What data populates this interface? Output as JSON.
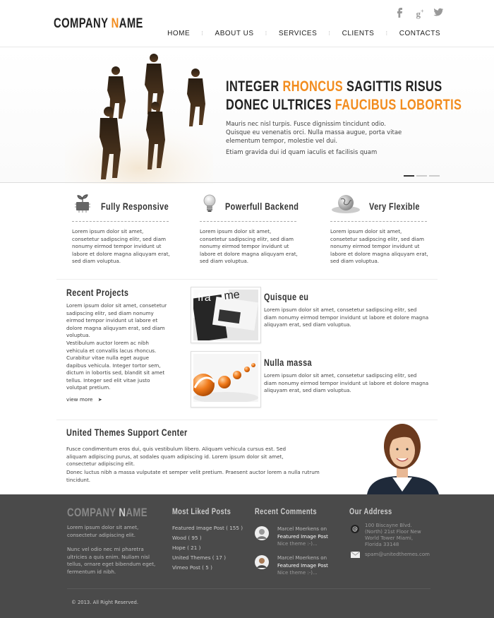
{
  "header": {
    "logo_part1": "COMPANY ",
    "logo_accent": "N",
    "logo_part2": "AME",
    "social": [
      "f",
      "g+",
      "twitter"
    ],
    "nav": [
      "HOME",
      "ABOUT US",
      "SERVICES",
      "CLIENTS",
      "CONTACTS"
    ]
  },
  "hero": {
    "line1_a": "INTEGER ",
    "line1_accent": "RHONCUS",
    "line1_b": " SAGITTIS RISUS",
    "line2_a": "DONEC ULTRICES ",
    "line2_accent": "FAUCIBUS LOBORTIS",
    "paragraph": "Mauris nec nisl turpis. Fusce dignissim tincidunt odio. Quisque eu venenatis orci. Nulla massa augue, porta vitae elementum tempor, molestie vel dui.",
    "paragraph2": "Etiam gravida dui id quam iaculis et facilisis quam"
  },
  "features": [
    {
      "title": "Fully Responsive",
      "icon": "chip-plant-icon",
      "text": "Lorem ipsum dolor sit amet, consetetur sadipscing elitr, sed diam nonumy eirmod tempor invidunt ut labore et dolore magna aliquyam erat, sed diam voluptua."
    },
    {
      "title": "Powerfull Backend",
      "icon": "lightbulb-icon",
      "text": "Lorem ipsum dolor sit amet, consetetur sadipscing elitr, sed diam nonumy eirmod tempor invidunt ut labore et dolore magna aliquyam erat, sed diam voluptua."
    },
    {
      "title": "Very Flexible",
      "icon": "globe-icon",
      "text": "Lorem ipsum dolor sit amet, consetetur sadipscing elitr, sed diam nonumy eirmod tempor invidunt ut labore et dolore magna aliquyam erat, sed diam voluptua."
    }
  ],
  "recent": {
    "title": "Recent Projects",
    "p1": "Lorem ipsum dolor sit amet, consetetur sadipscing elitr, sed diam nonumy eirmod tempor invidunt ut labore et dolore magna aliquyam erat, sed diam voluptua.",
    "p2": "Vestibulum auctor lorem ac nibh vehicula et convallis lacus rhoncus. Curabitur vitae nulla eget augue dapibus vehicula. Integer tortor sem, dictum in lobortis sed, blandit sit amet tellus. Integer sed elit vitae justo volutpat pretium.",
    "view_more": "view more",
    "projects": [
      {
        "title": "Quisque eu",
        "thumb_text": "frame",
        "text": "Lorem ipsum dolor sit amet, consetetur sadipscing elitr, sed diam nonumy eirmod tempor invidunt ut labore et dolore magna aliquyam erat, sed diam voluptua."
      },
      {
        "title": "Nulla massa",
        "text": "Lorem ipsum dolor sit amet, consetetur sadipscing elitr, sed diam nonumy eirmod tempor invidunt ut labore et dolore magna aliquyam erat, sed diam voluptua."
      }
    ]
  },
  "support": {
    "title": "United Themes Support Center",
    "p1": "Fusce condimentum eros dui, quis vestibulum libero. Aliquam vehicula cursus est. Sed aliquam adipiscing purus, at sodales quam adipiscing id. Lorem ipsum dolor sit amet, consectetur adipiscing elit.",
    "p2": "Donec luctus nibh a massa vulputate et semper velit pretium. Praesent auctor lorem a nulla rutrum tincidunt."
  },
  "footer": {
    "logo_part1": "COMPANY ",
    "logo_accent": "N",
    "logo_part2": "AME",
    "about1": "Lorem ipsum dolor sit amet, consectetur adipiscing elit.",
    "about2": "Nunc vel odio nec mi pharetra ultricies a quis enim. Nullam nisl tellus, ornare eget bibendum eget, fermentum id nibh.",
    "liked_title": "Most Liked Posts",
    "liked": [
      "Featured Image Post ( 155 )",
      "Wood ( 95 )",
      "Hope ( 21 )",
      "United Themes ( 17 )",
      "Vimeo Post ( 5 )"
    ],
    "comments_title": "Recent Comments",
    "comments": [
      {
        "author": "Marcel Moerkens on",
        "post": "Featured Image Post",
        "text": "Nice theme :-)..."
      },
      {
        "author": "Marcel Moerkens on",
        "post": "Featured Image Post",
        "text": "Nice theme :-)..."
      }
    ],
    "address_title": "Our Address",
    "address": [
      "100 Biscayne Blvd.",
      "(North) 21st Floor New",
      "World Tower Miami,",
      "Florida 33148"
    ],
    "email": "spam@unitedthemes.com",
    "copyright": "© 2013. All Right Reserved.",
    "colors": {
      "accent": "#f28c1e",
      "footer_bg": "#4a4a4a"
    }
  }
}
